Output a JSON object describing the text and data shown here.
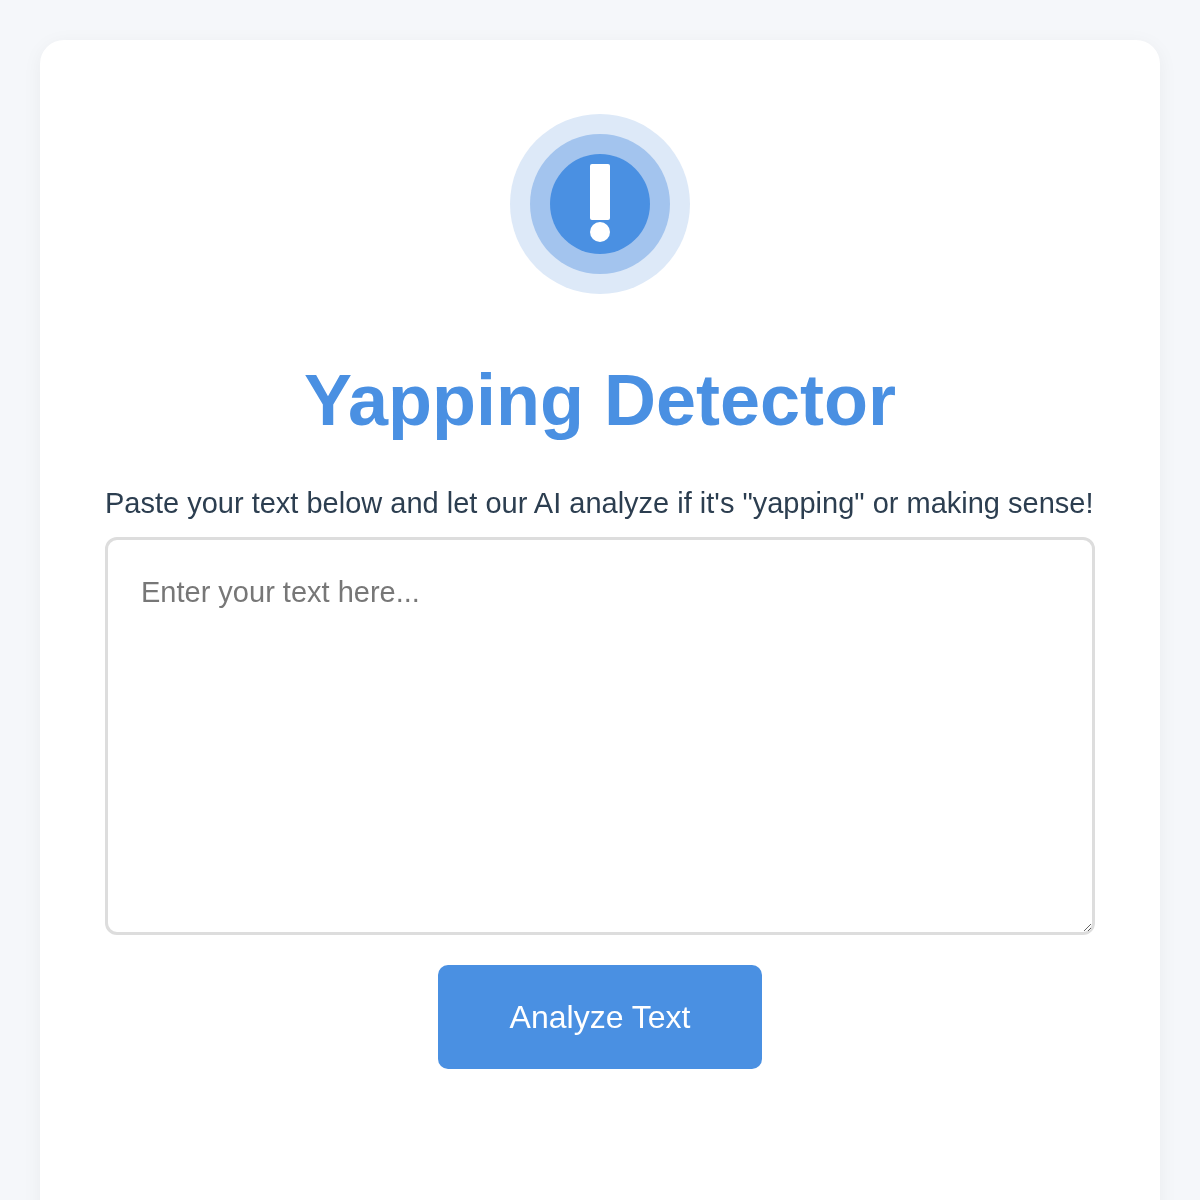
{
  "title": "Yapping Detector",
  "description": "Paste your text below and let our AI analyze if it's \"yapping\" or making sense!",
  "text_input": {
    "placeholder": "Enter your text here..."
  },
  "button": {
    "label": "Analyze Text"
  }
}
